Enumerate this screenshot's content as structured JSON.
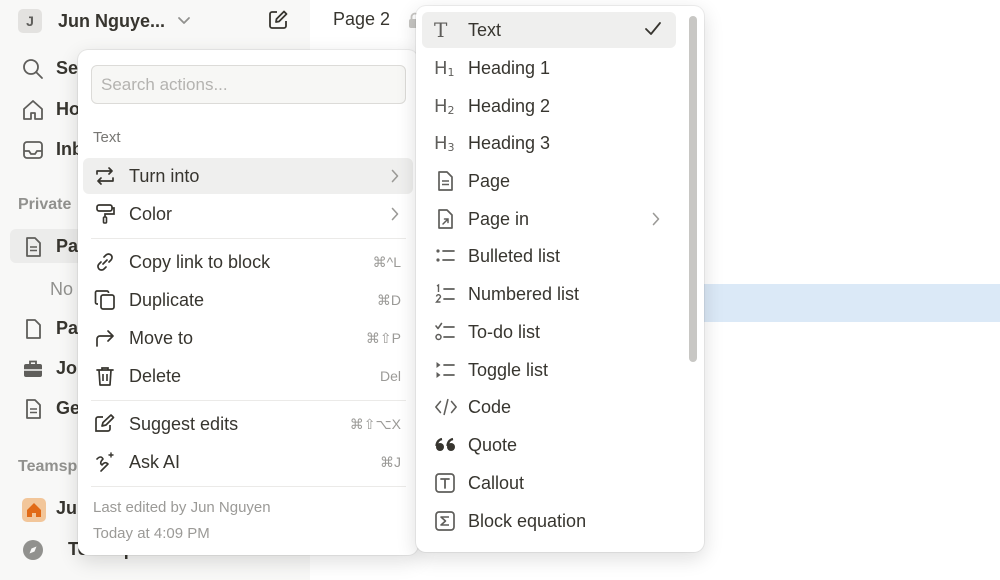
{
  "sidebar": {
    "workspace_initial": "J",
    "workspace_name": "Jun Nguye...",
    "nav": [
      {
        "label": "Se",
        "icon": "search-icon"
      },
      {
        "label": "Ho",
        "icon": "home-icon"
      },
      {
        "label": "Inb",
        "icon": "inbox-icon"
      }
    ],
    "private_label": "Private",
    "private_pages": [
      {
        "label": "Pa",
        "icon": "page-icon"
      },
      {
        "label": "Pa",
        "icon": "page-icon"
      },
      {
        "label": "Jo",
        "icon": "briefcase-icon"
      },
      {
        "label": "Ge",
        "icon": "document-icon"
      }
    ],
    "no_pages_label": "No",
    "teamspaces_label": "Teamsp",
    "teamspaces": [
      {
        "label": "Ju",
        "icon": "home-badge-icon"
      },
      {
        "label": "Teamspace Home",
        "icon": "compass-icon"
      }
    ]
  },
  "topbar": {
    "page_title": "Page 2"
  },
  "block_menu": {
    "search_placeholder": "Search actions...",
    "section_label": "Text",
    "items": [
      {
        "label": "Turn into",
        "icon": "turn-into-icon",
        "shortcut": ""
      },
      {
        "label": "Color",
        "icon": "paint-roller-icon",
        "shortcut": ""
      },
      {
        "label": "Copy link to block",
        "icon": "link-icon",
        "shortcut": "⌘^L"
      },
      {
        "label": "Duplicate",
        "icon": "duplicate-icon",
        "shortcut": "⌘D"
      },
      {
        "label": "Move to",
        "icon": "move-arrow-icon",
        "shortcut": "⌘⇧P"
      },
      {
        "label": "Delete",
        "icon": "trash-icon",
        "shortcut": "Del"
      },
      {
        "label": "Suggest edits",
        "icon": "suggest-edit-icon",
        "shortcut": "⌘⇧⌥X"
      },
      {
        "label": "Ask AI",
        "icon": "ai-sparkle-icon",
        "shortcut": "⌘J"
      }
    ],
    "footer_line1": "Last edited by Jun Nguyen",
    "footer_line2": "Today at 4:09 PM"
  },
  "turn_into_menu": {
    "items": [
      {
        "label": "Text",
        "icon": "text-icon",
        "selected": true
      },
      {
        "label": "Heading 1",
        "icon": "heading-1-icon"
      },
      {
        "label": "Heading 2",
        "icon": "heading-2-icon"
      },
      {
        "label": "Heading 3",
        "icon": "heading-3-icon"
      },
      {
        "label": "Page",
        "icon": "page-icon"
      },
      {
        "label": "Page in",
        "icon": "page-in-icon"
      },
      {
        "label": "Bulleted list",
        "icon": "bulleted-list-icon"
      },
      {
        "label": "Numbered list",
        "icon": "numbered-list-icon"
      },
      {
        "label": "To-do list",
        "icon": "todo-list-icon"
      },
      {
        "label": "Toggle list",
        "icon": "toggle-list-icon"
      },
      {
        "label": "Code",
        "icon": "code-icon"
      },
      {
        "label": "Quote",
        "icon": "quote-icon"
      },
      {
        "label": "Callout",
        "icon": "callout-icon"
      },
      {
        "label": "Block equation",
        "icon": "equation-icon"
      }
    ],
    "heading_glyph": "H",
    "heading_levels": [
      "1",
      "2",
      "3"
    ],
    "text_glyph": "T"
  },
  "colors": {
    "selection_highlight": "#dbe9f7",
    "menu_hover": "#efefee",
    "sidebar_bg": "#f8f8f7",
    "teamspace_badge": "#f2c69a"
  }
}
